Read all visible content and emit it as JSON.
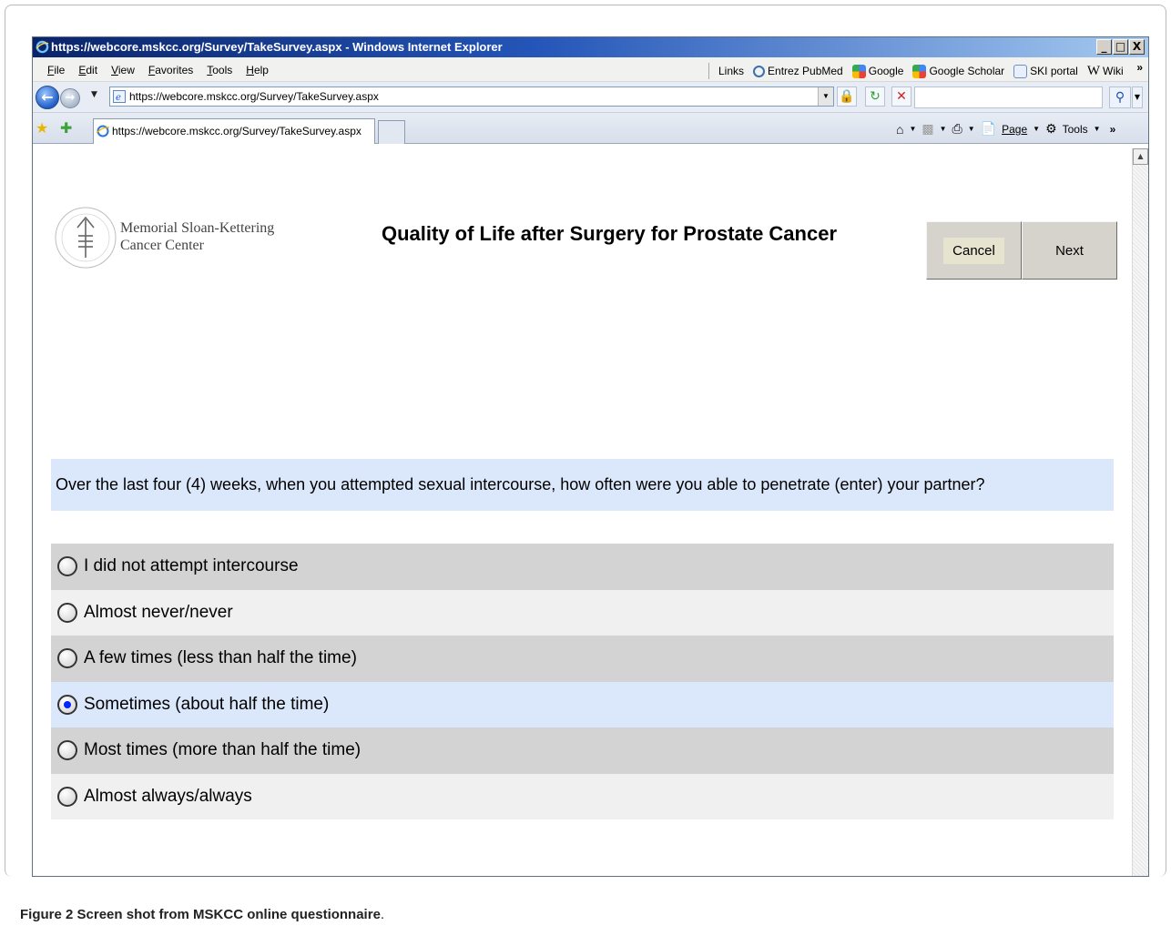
{
  "window": {
    "title": "https://webcore.mskcc.org/Survey/TakeSurvey.aspx - Windows Internet Explorer",
    "controls": [
      "_",
      "□",
      "X"
    ]
  },
  "menu": {
    "items": [
      "File",
      "Edit",
      "View",
      "Favorites",
      "Tools",
      "Help"
    ],
    "links_label": "Links",
    "links": [
      "Entrez PubMed",
      "Google",
      "Google Scholar",
      "SKI portal",
      "Wiki"
    ],
    "more": "»"
  },
  "address": {
    "url": "https://webcore.mskcc.org/Survey/TakeSurvey.aspx",
    "search_value": ""
  },
  "tabs": {
    "active": "https://webcore.mskcc.org/Survey/TakeSurvey.aspx"
  },
  "command_bar": {
    "page": "Page",
    "tools": "Tools",
    "more": "»"
  },
  "page": {
    "org_name_line1": "Memorial Sloan-Kettering",
    "org_name_line2": "Cancer Center",
    "title": "Quality of Life after Surgery for Prostate Cancer",
    "cancel_label": "Cancel",
    "next_label": "Next",
    "question": "Over the last four (4) weeks, when you attempted sexual intercourse, how often were you able to penetrate (enter) your partner?",
    "options": [
      {
        "label": "I did not attempt intercourse",
        "selected": false
      },
      {
        "label": "Almost never/never",
        "selected": false
      },
      {
        "label": "A few times (less than half the time)",
        "selected": false
      },
      {
        "label": "Sometimes (about half the time)",
        "selected": true
      },
      {
        "label": "Most times (more than half the time)",
        "selected": false
      },
      {
        "label": "Almost always/always",
        "selected": false
      }
    ]
  },
  "caption": {
    "label": "Figure 2",
    "text": "Screen shot from MSKCC online questionnaire",
    "end": "."
  },
  "colors": {
    "question_bg": "#dbe7fb",
    "option_dark": "#d3d3d3",
    "option_light": "#f0f0f0",
    "radio_dot": "#0026ff"
  }
}
